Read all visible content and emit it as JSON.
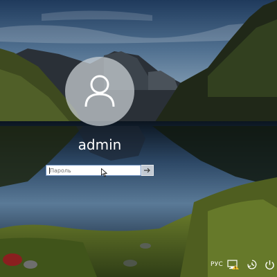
{
  "login": {
    "username": "admin",
    "password_placeholder": "Пароль",
    "password_value": ""
  },
  "tray": {
    "language": "РУС",
    "icons": [
      "network-icon",
      "ease-of-access-icon",
      "power-icon"
    ]
  },
  "colors": {
    "avatar_circle": "#cdd2d7",
    "input_border": "#6c8fbf",
    "text": "#ffffff"
  }
}
